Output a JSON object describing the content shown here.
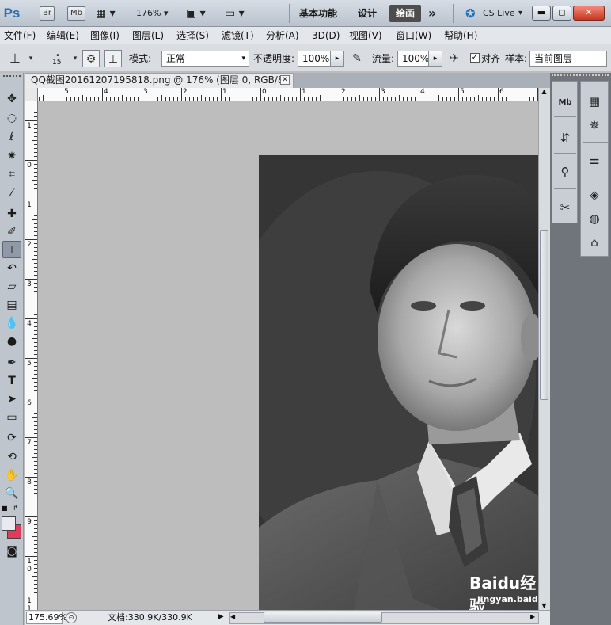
{
  "titlebar": {
    "app_logo": "Ps",
    "br_label": "Br",
    "mb_label": "Mb",
    "zoom_value": "176%",
    "workspaces": [
      "基本功能",
      "设计",
      "绘画"
    ],
    "active_workspace": "绘画",
    "more_icon": "»",
    "cs_live": "CS Live"
  },
  "menu": [
    "文件(F)",
    "编辑(E)",
    "图像(I)",
    "图层(L)",
    "选择(S)",
    "滤镜(T)",
    "分析(A)",
    "3D(D)",
    "视图(V)",
    "窗口(W)",
    "帮助(H)"
  ],
  "options": {
    "brush_size": "15",
    "mode_label": "模式:",
    "mode_value": "正常",
    "opacity_label": "不透明度:",
    "opacity_value": "100%",
    "flow_label": "流量:",
    "flow_value": "100%",
    "aligned_label": "对齐",
    "aligned_checked": true,
    "sample_label": "样本:",
    "sample_value": "当前图层"
  },
  "document": {
    "tab_title": "QQ截图20161207195818.png @ 176% (图层 0, RGB/8) *"
  },
  "ruler_top": [
    "5",
    "4",
    "3",
    "2",
    "1",
    "0",
    "1",
    "2",
    "3",
    "4",
    "5",
    "6",
    "7"
  ],
  "ruler_left": [
    "1",
    "0",
    "1",
    "2",
    "3",
    "4",
    "5",
    "6",
    "7",
    "8",
    "9",
    "1 0",
    "1 1"
  ],
  "status": {
    "zoom": "175.69%",
    "doc": "文档:330.9K/330.9K"
  },
  "watermark": {
    "brand": "Baidu",
    "suffix": "经验",
    "url": "jingyan.baidu.com"
  },
  "colors": {
    "foreground": "#e8eaf0",
    "background": "#e03a5c"
  }
}
